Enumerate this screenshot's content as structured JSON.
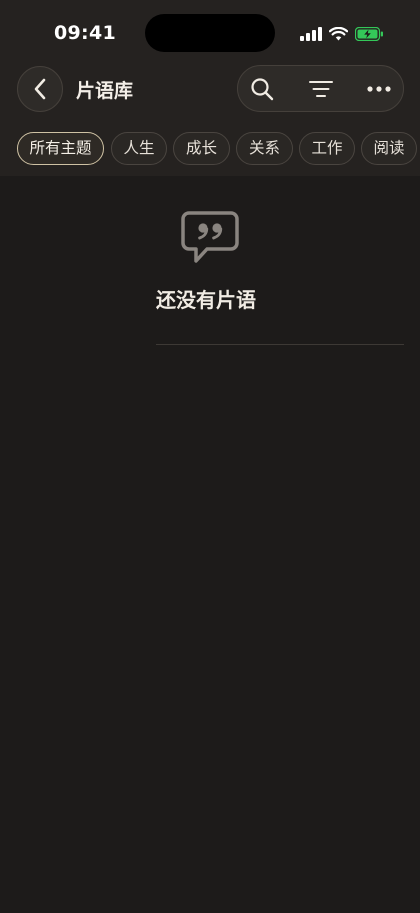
{
  "status_bar": {
    "time": "09:41"
  },
  "header": {
    "title": "片语库"
  },
  "chips": [
    {
      "label": "所有主题",
      "active": true
    },
    {
      "label": "人生",
      "active": false
    },
    {
      "label": "成长",
      "active": false
    },
    {
      "label": "关系",
      "active": false
    },
    {
      "label": "工作",
      "active": false
    },
    {
      "label": "阅读",
      "active": false
    }
  ],
  "empty_state": {
    "message": "还没有片语"
  },
  "colors": {
    "background": "#1d1b1a",
    "header_background": "#252220",
    "active_chip_border": "#cfc2a4",
    "battery_green": "#34c759"
  }
}
